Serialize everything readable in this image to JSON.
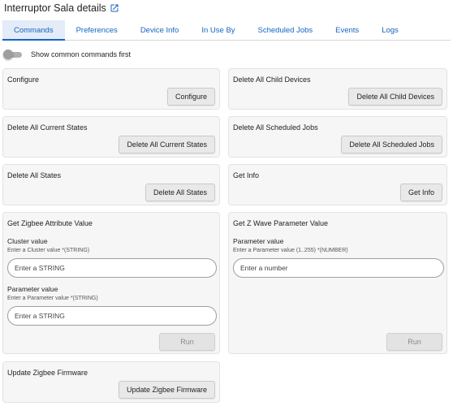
{
  "header": {
    "title": "Interruptor Sala details",
    "link_icon": "external-link-icon"
  },
  "tabs": [
    {
      "label": "Commands",
      "active": true
    },
    {
      "label": "Preferences"
    },
    {
      "label": "Device Info"
    },
    {
      "label": "In Use By"
    },
    {
      "label": "Scheduled Jobs"
    },
    {
      "label": "Events"
    },
    {
      "label": "Logs"
    }
  ],
  "toggle": {
    "label": "Show common commands first",
    "on": false
  },
  "commands": {
    "configure": {
      "title": "Configure",
      "button": "Configure"
    },
    "delete_child_devices": {
      "title": "Delete All Child Devices",
      "button": "Delete All Child Devices"
    },
    "delete_current_states": {
      "title": "Delete All Current States",
      "button": "Delete All Current States"
    },
    "delete_scheduled_jobs": {
      "title": "Delete All Scheduled Jobs",
      "button": "Delete All Scheduled Jobs"
    },
    "delete_states": {
      "title": "Delete All States",
      "button": "Delete All States"
    },
    "get_info": {
      "title": "Get Info",
      "button": "Get Info"
    },
    "zigbee_attr": {
      "title": "Get Zigbee Attribute Value",
      "cluster_label": "Cluster value",
      "cluster_hint": "Enter a Cluster value *(STRING)",
      "cluster_placeholder": "Enter a STRING",
      "param_label": "Parameter value",
      "param_hint": "Enter a Parameter value *(STRING)",
      "param_placeholder": "Enter a STRING",
      "button": "Run"
    },
    "zwave_param": {
      "title": "Get Z Wave Parameter Value",
      "param_label": "Parameter value",
      "param_hint": "Enter a Parameter value (1..255) *(NUMBER)",
      "param_placeholder": "Enter a number",
      "button": "Run"
    },
    "update_firmware": {
      "title": "Update Zigbee Firmware",
      "button": "Update Zigbee Firmware"
    }
  }
}
